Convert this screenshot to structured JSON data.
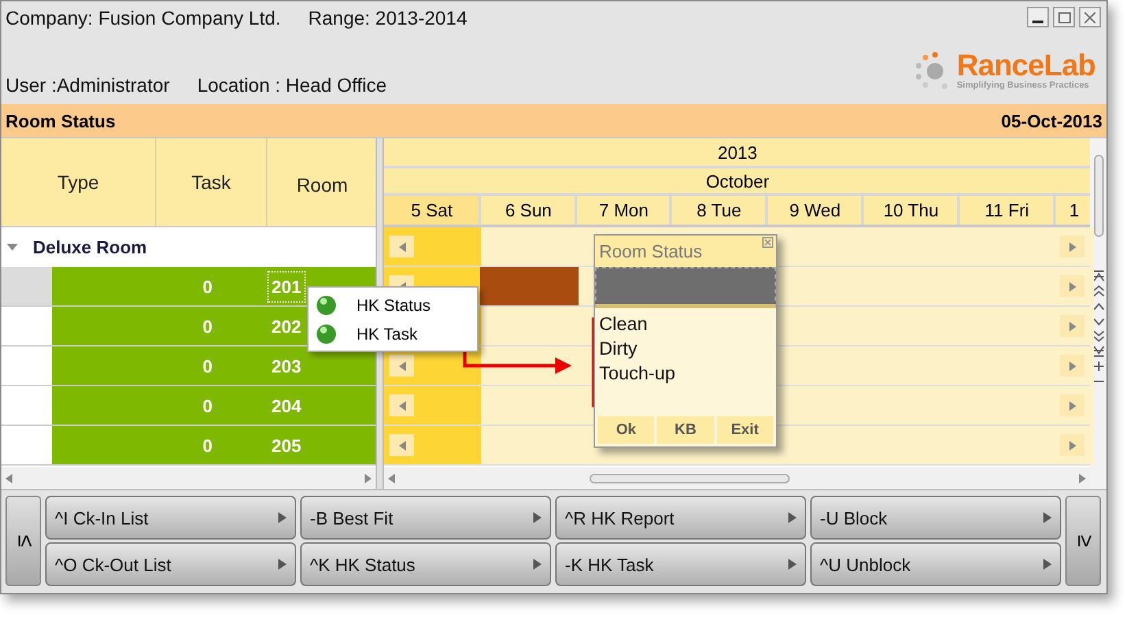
{
  "header": {
    "company": "Company: Fusion Company Ltd.",
    "range": "Range: 2013-2014",
    "user": "User :Administrator",
    "location": "Location : Head Office"
  },
  "logo": {
    "name": "RanceLab",
    "tagline": "Simplifying Business Practices"
  },
  "title_bar": {
    "title": "Room Status",
    "date": "05-Oct-2013"
  },
  "grid": {
    "columns": [
      "Type",
      "Task",
      "Room"
    ],
    "group": {
      "label": "Deluxe Room",
      "expanded": true
    },
    "rows": [
      {
        "task": "0",
        "room": "201",
        "selected": true,
        "booked": true
      },
      {
        "task": "0",
        "room": "202",
        "selected": false,
        "booked": false
      },
      {
        "task": "0",
        "room": "203",
        "selected": false,
        "booked": false
      },
      {
        "task": "0",
        "room": "204",
        "selected": false,
        "booked": false
      },
      {
        "task": "0",
        "room": "205",
        "selected": false,
        "booked": false
      }
    ]
  },
  "calendar": {
    "year": "2013",
    "month": "October",
    "days": [
      {
        "label": "5 Sat",
        "selected": true
      },
      {
        "label": "6 Sun",
        "selected": false
      },
      {
        "label": "7 Mon",
        "selected": false
      },
      {
        "label": "8 Tue",
        "selected": false
      },
      {
        "label": "9 Wed",
        "selected": false
      },
      {
        "label": "10 Thu",
        "selected": false
      },
      {
        "label": "11 Fri",
        "selected": false
      },
      {
        "label": "1",
        "selected": false
      }
    ]
  },
  "context_menu": {
    "items": [
      "HK Status",
      "HK Task"
    ]
  },
  "dialog": {
    "title": "Room Status",
    "options": [
      "Clean",
      "Dirty",
      "Touch-up"
    ],
    "buttons": [
      "Ok",
      "KB",
      "Exit"
    ]
  },
  "toolbar": {
    "prev": "≤",
    "next": "≥",
    "buttons": [
      "^I Ck-In List",
      "-B Best Fit",
      "^R HK Report",
      "-U Block",
      "^O Ck-Out List",
      "^K HK Status",
      "-K HK Task",
      "^U Unblock"
    ]
  }
}
